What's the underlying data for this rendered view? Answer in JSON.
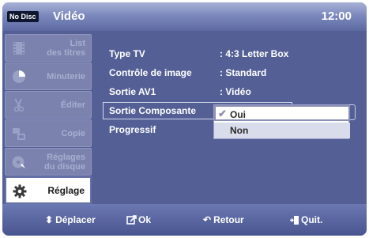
{
  "header": {
    "badge": "No Disc",
    "title": "Vidéo",
    "clock": "12:00"
  },
  "sidebar": {
    "items": [
      {
        "label_line1": "List",
        "label_line2": "des titres",
        "icon": "film-icon",
        "active": false
      },
      {
        "label_line1": "Minuterie",
        "label_line2": "",
        "icon": "timer-icon",
        "active": false
      },
      {
        "label_line1": "Éditer",
        "label_line2": "",
        "icon": "scissors-icon",
        "active": false
      },
      {
        "label_line1": "Copie",
        "label_line2": "",
        "icon": "copy-icon",
        "active": false
      },
      {
        "label_line1": "Réglages",
        "label_line2": "du disque",
        "icon": "disc-icon",
        "active": false
      },
      {
        "label_line1": "Réglage",
        "label_line2": "",
        "icon": "gear-icon",
        "active": true
      }
    ]
  },
  "settings": {
    "rows": [
      {
        "label": "Type TV",
        "value": ": 4:3 Letter Box"
      },
      {
        "label": "Contrôle de image",
        "value": ": Standard"
      },
      {
        "label": "Sortie AV1",
        "value": ": Vidéo"
      },
      {
        "label": "Sortie Composante",
        "value": ""
      },
      {
        "label": "Progressif",
        "value": ""
      }
    ]
  },
  "dropdown": {
    "selected": "Oui",
    "options": [
      "Oui",
      "Non"
    ]
  },
  "footer": {
    "move": "Déplacer",
    "ok": "Ok",
    "back": "Retour",
    "quit": "Quit."
  },
  "colors": {
    "background": "#535f95",
    "topbar": "#7c89bd",
    "active_item": "#ffffff"
  }
}
